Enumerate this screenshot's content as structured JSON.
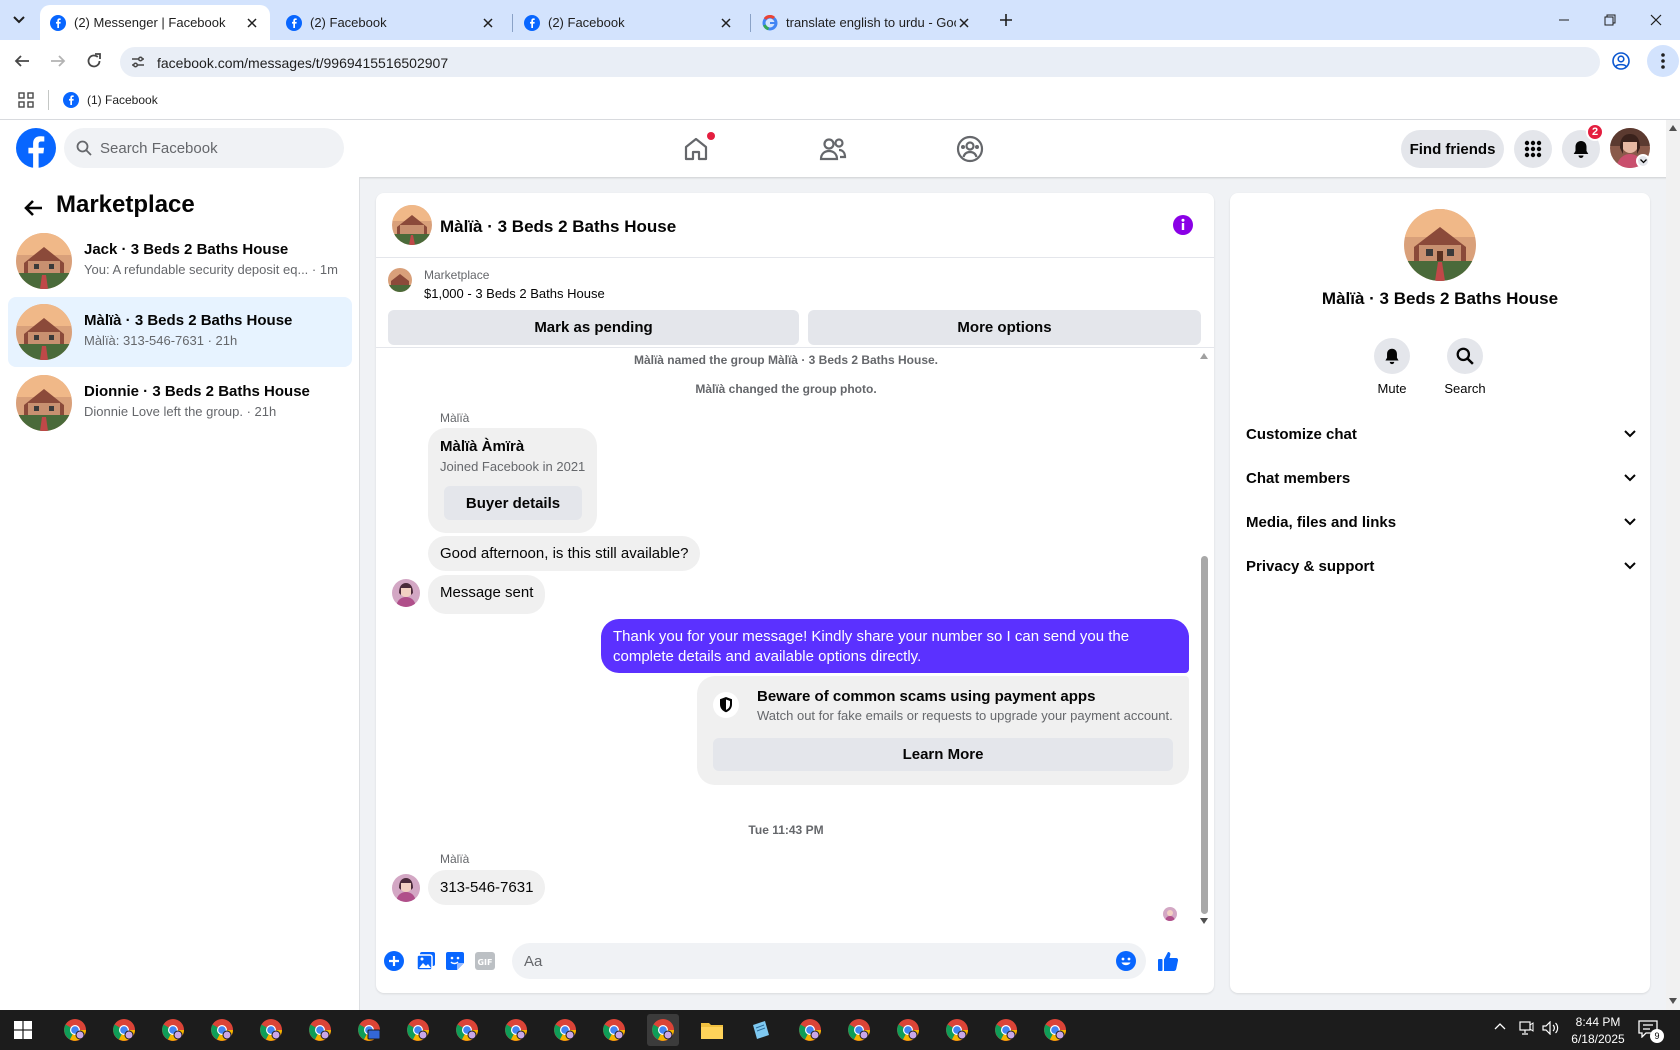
{
  "browser": {
    "tabs": [
      {
        "title": "(2) Messenger | Facebook",
        "icon": "facebook-icon",
        "active": true
      },
      {
        "title": "(2) Facebook",
        "icon": "facebook-icon",
        "active": false
      },
      {
        "title": "(2) Facebook",
        "icon": "facebook-icon",
        "active": false
      },
      {
        "title": "translate english to urdu - Goo",
        "icon": "google-icon",
        "active": false
      }
    ],
    "url": "facebook.com/messages/t/9969415516502907",
    "bookmark": "(1) Facebook"
  },
  "header": {
    "search_placeholder": "Search Facebook",
    "find_friends": "Find friends",
    "notification_count": "2"
  },
  "sidebar": {
    "title": "Marketplace",
    "conversations": [
      {
        "name": "Jack · 3 Beds 2 Baths House",
        "preview": "You: A refundable security deposit eq... · 1m"
      },
      {
        "name": "Màlïà · 3 Beds 2 Baths House",
        "preview": "Màlïà: 313-546-7631 · 21h"
      },
      {
        "name": "Dionnie · 3 Beds 2 Baths House",
        "preview": "Dionnie Love left the group. · 21h"
      }
    ]
  },
  "chat": {
    "title": "Màlïà · 3 Beds 2 Baths House",
    "listing": {
      "label": "Marketplace",
      "price_title": "$1,000 - 3 Beds 2 Baths House",
      "mark_pending": "Mark as pending",
      "more_options": "More options"
    },
    "system_messages": [
      "Màlïà named the group Màlïà · 3 Beds 2 Baths House.",
      "Màlïà changed the group photo."
    ],
    "sender_name": "Màlïà",
    "buyer_card": {
      "name": "Màlïà Àmïrà",
      "joined": "Joined Facebook in 2021",
      "button": "Buyer details"
    },
    "incoming_1": "Good afternoon, is this still available?",
    "incoming_2": "Message sent",
    "outgoing": "Thank you for your message! Kindly share your number so I can send you the complete details and available options directly.",
    "scam_notice": {
      "title": "Beware of common scams using payment apps",
      "description": "Watch out for fake emails or requests to upgrade your payment account.",
      "button": "Learn More"
    },
    "timestamp": "Tue 11:43 PM",
    "incoming_3": "313-546-7631",
    "input_placeholder": "Aa"
  },
  "details": {
    "name": "Màlïà · 3 Beds 2 Baths House",
    "actions": [
      {
        "label": "Mute",
        "icon": "bell-icon"
      },
      {
        "label": "Search",
        "icon": "search-icon"
      }
    ],
    "sections": [
      "Customize chat",
      "Chat members",
      "Media, files and links",
      "Privacy & support"
    ]
  },
  "taskbar": {
    "time": "8:44 PM",
    "date": "6/18/2025",
    "notification_count": "9"
  },
  "colors": {
    "facebook_blue": "#0866ff",
    "messenger_purple": "#5b31ff",
    "selected_row": "#e7f3ff",
    "badge_red": "#e41e3f"
  }
}
